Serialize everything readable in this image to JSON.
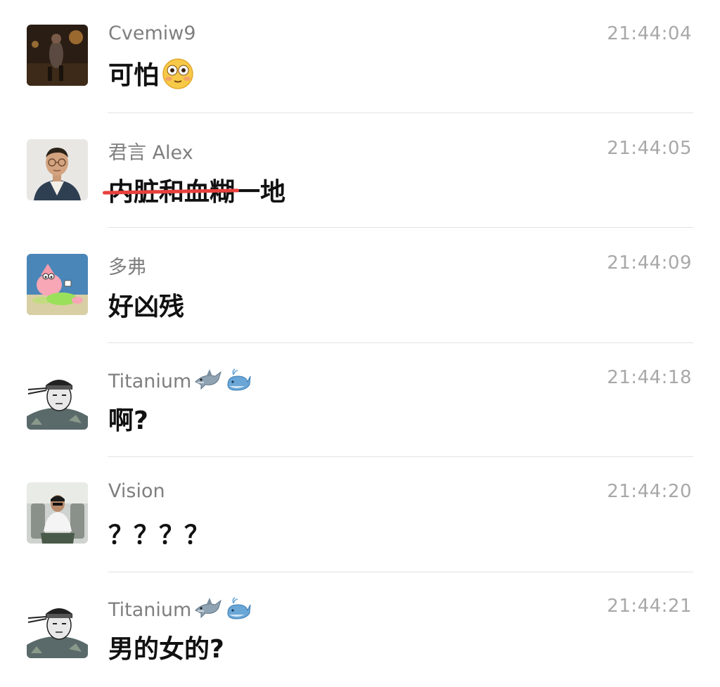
{
  "messages": [
    {
      "name": "Cvemiw9",
      "time": "21:44:04",
      "text": "可怕",
      "text_emoji": "flushed-face-icon"
    },
    {
      "name": "君言 Alex",
      "time": "21:44:05",
      "text_struck": "内脏和血糊",
      "text": "一地",
      "strike_color": "#e8403d"
    },
    {
      "name": "多弗",
      "time": "21:44:09",
      "text": "好凶残"
    },
    {
      "name": "Titanium",
      "name_emoji": [
        "shark-icon",
        "whale-icon"
      ],
      "time": "21:44:18",
      "text": "啊?"
    },
    {
      "name": "Vision",
      "time": "21:44:20",
      "text": "？？？？"
    },
    {
      "name": "Titanium",
      "name_emoji": [
        "shark-icon",
        "whale-icon"
      ],
      "time": "21:44:21",
      "text": "男的女的?"
    }
  ]
}
